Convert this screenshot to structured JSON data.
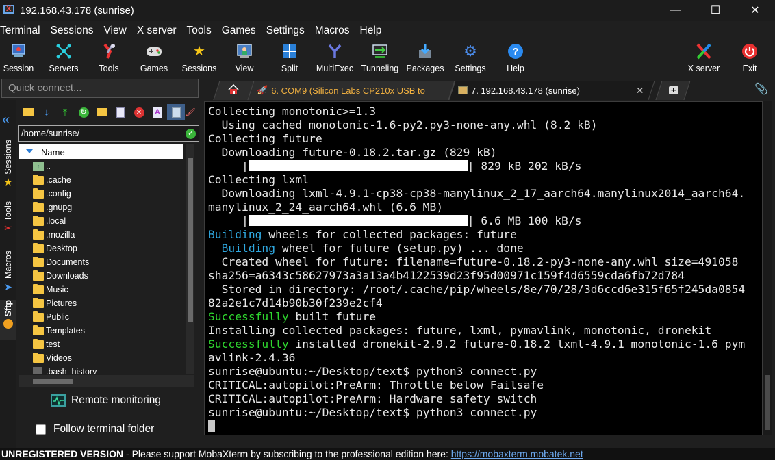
{
  "window": {
    "title": "192.168.43.178 (sunrise)",
    "controls": {
      "minimize": "—",
      "maximize": "☐",
      "close": "✕"
    }
  },
  "menu": [
    "Terminal",
    "Sessions",
    "View",
    "X server",
    "Tools",
    "Games",
    "Settings",
    "Macros",
    "Help"
  ],
  "toolbar": [
    {
      "label": "Session",
      "icon": "session-icon"
    },
    {
      "label": "Servers",
      "icon": "servers-icon"
    },
    {
      "label": "Tools",
      "icon": "tools-icon"
    },
    {
      "label": "Games",
      "icon": "gamepad-icon"
    },
    {
      "label": "Sessions",
      "icon": "star-icon"
    },
    {
      "label": "View",
      "icon": "view-icon"
    },
    {
      "label": "Split",
      "icon": "split-icon"
    },
    {
      "label": "MultiExec",
      "icon": "fork-icon"
    },
    {
      "label": "Tunneling",
      "icon": "tunneling-icon"
    },
    {
      "label": "Packages",
      "icon": "download-icon"
    },
    {
      "label": "Settings",
      "icon": "gear-icon"
    },
    {
      "label": "Help",
      "icon": "question-icon"
    },
    {
      "label": "X server",
      "icon": "x-server-icon"
    },
    {
      "label": "Exit",
      "icon": "power-icon"
    }
  ],
  "quick_connect": {
    "placeholder": "Quick connect..."
  },
  "tabs": [
    {
      "label": "",
      "icon": "home-icon"
    },
    {
      "label": "6. COM9  (Silicon Labs CP210x USB to",
      "icon": "serial-icon"
    },
    {
      "label": "7. 192.168.43.178 (sunrise)",
      "icon": "ssh-icon",
      "close": "✕"
    },
    {
      "label": "+",
      "icon": "new-tab-icon"
    }
  ],
  "side_tabs": [
    "Sessions",
    "Tools",
    "Macros",
    "Sftp"
  ],
  "sftp": {
    "path": "/home/sunrise/",
    "column_header": "Name",
    "files": [
      "..",
      ".cache",
      ".config",
      ".gnupg",
      ".local",
      ".mozilla",
      "Desktop",
      "Documents",
      "Downloads",
      "Music",
      "Pictures",
      "Public",
      "Templates",
      "test",
      "Videos",
      ".bash_history"
    ],
    "remote_monitoring": "Remote monitoring",
    "follow_terminal": "Follow terminal folder"
  },
  "terminal": {
    "lines": [
      {
        "segments": [
          {
            "text": "Collecting monotonic>=1.3"
          }
        ]
      },
      {
        "segments": [
          {
            "text": "  Using cached monotonic-1.6-py2.py3-none-any.whl (8.2 kB)"
          }
        ]
      },
      {
        "segments": [
          {
            "text": "Collecting future"
          }
        ]
      },
      {
        "segments": [
          {
            "text": "  Downloading future-0.18.2.tar.gz (829 kB)"
          }
        ]
      },
      {
        "segments": [
          {
            "text": "     |"
          },
          {
            "bar": true
          },
          {
            "text": "| 829 kB 202 kB/s"
          }
        ]
      },
      {
        "segments": [
          {
            "text": "Collecting lxml"
          }
        ]
      },
      {
        "segments": [
          {
            "text": "  Downloading lxml-4.9.1-cp38-cp38-manylinux_2_17_aarch64.manylinux2014_aarch64."
          }
        ]
      },
      {
        "segments": [
          {
            "text": "manylinux_2_24_aarch64.whl (6.6 MB)"
          }
        ]
      },
      {
        "segments": [
          {
            "text": "     |"
          },
          {
            "bar": true
          },
          {
            "text": "| 6.6 MB 100 kB/s"
          }
        ]
      },
      {
        "segments": [
          {
            "text": "Building",
            "color": "cyan"
          },
          {
            "text": " wheels for collected packages: future"
          }
        ]
      },
      {
        "segments": [
          {
            "text": "  "
          },
          {
            "text": "Building",
            "color": "cyan"
          },
          {
            "text": " wheel for future (setup.py) ... done"
          }
        ]
      },
      {
        "segments": [
          {
            "text": "  Created wheel for future: filename=future-0.18.2-py3-none-any.whl size=491058"
          }
        ]
      },
      {
        "segments": [
          {
            "text": "sha256=a6343c58627973a3a13a4b4122539d23f95d00971c159f4d6559cda6fb72d784"
          }
        ]
      },
      {
        "segments": [
          {
            "text": "  Stored in directory: /root/.cache/pip/wheels/8e/70/28/3d6ccd6e315f65f245da0854"
          }
        ]
      },
      {
        "segments": [
          {
            "text": "82a2e1c7d14b90b30f239e2cf4"
          }
        ]
      },
      {
        "segments": [
          {
            "text": "Successfully",
            "color": "green"
          },
          {
            "text": " built future"
          }
        ]
      },
      {
        "segments": [
          {
            "text": "Installing collected packages: future, lxml, pymavlink, monotonic, dronekit"
          }
        ]
      },
      {
        "segments": [
          {
            "text": "Successfully",
            "color": "green"
          },
          {
            "text": " installed dronekit-2.9.2 future-0.18.2 lxml-4.9.1 monotonic-1.6 pym"
          }
        ]
      },
      {
        "segments": [
          {
            "text": "avlink-2.4.36"
          }
        ]
      },
      {
        "segments": [
          {
            "text": "sunrise@ubuntu:~/Desktop/text$ python3 connect.py"
          }
        ]
      },
      {
        "segments": [
          {
            "text": "CRITICAL:autopilot:PreArm: Throttle below Failsafe"
          }
        ]
      },
      {
        "segments": [
          {
            "text": "CRITICAL:autopilot:PreArm: Hardware safety switch"
          }
        ]
      },
      {
        "segments": [
          {
            "text": "sunrise@ubuntu:~/Desktop/text$ python3 connect.py"
          }
        ]
      },
      {
        "segments": [
          {
            "cursor": true
          }
        ]
      }
    ]
  },
  "status": {
    "unregistered": "UNREGISTERED VERSION",
    "message": "  -  Please support MobaXterm by subscribing to the professional edition here:  ",
    "link": "https://mobaxterm.mobatek.net"
  }
}
